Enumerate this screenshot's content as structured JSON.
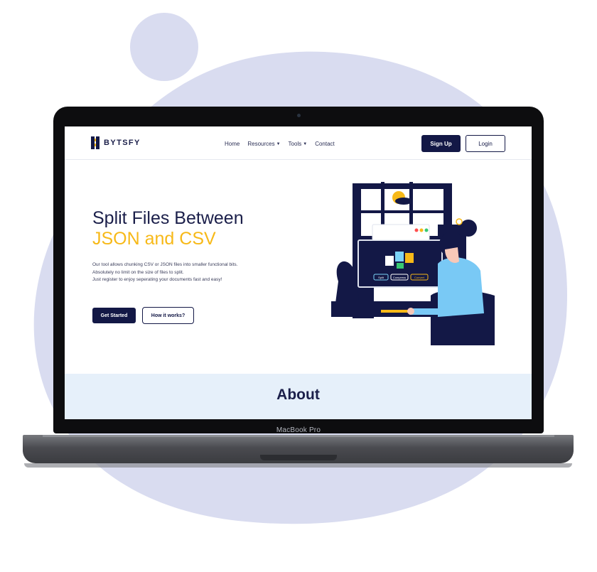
{
  "device_label": "MacBook Pro",
  "brand": {
    "name": "BYTSFY"
  },
  "nav": {
    "links": [
      {
        "label": "Home"
      },
      {
        "label": "Resources",
        "dropdown": true
      },
      {
        "label": "Tools",
        "dropdown": true
      },
      {
        "label": "Contact"
      }
    ],
    "signup_label": "Sign Up",
    "login_label": "Login"
  },
  "hero": {
    "title_line1": "Split Files Between",
    "title_line2": "JSON and CSV",
    "description": [
      "Our tool allows chunking CSV or JSON files into smaller functional bits.",
      "Absolutely no limit on the size of files to split.",
      "Just register to enjoy seperating your documents fast and easy!"
    ],
    "cta_primary": "Get Started",
    "cta_secondary": "How it works?",
    "illustration_buttons": [
      "Split",
      "Compress",
      "Convert"
    ]
  },
  "about": {
    "title": "About"
  },
  "colors": {
    "navy": "#131846",
    "accent": "#f7b918",
    "about_bg": "#e6f0fa",
    "blob": "#d9dcf0"
  },
  "icons": [
    "logo-mark-icon",
    "caret-down-icon"
  ]
}
